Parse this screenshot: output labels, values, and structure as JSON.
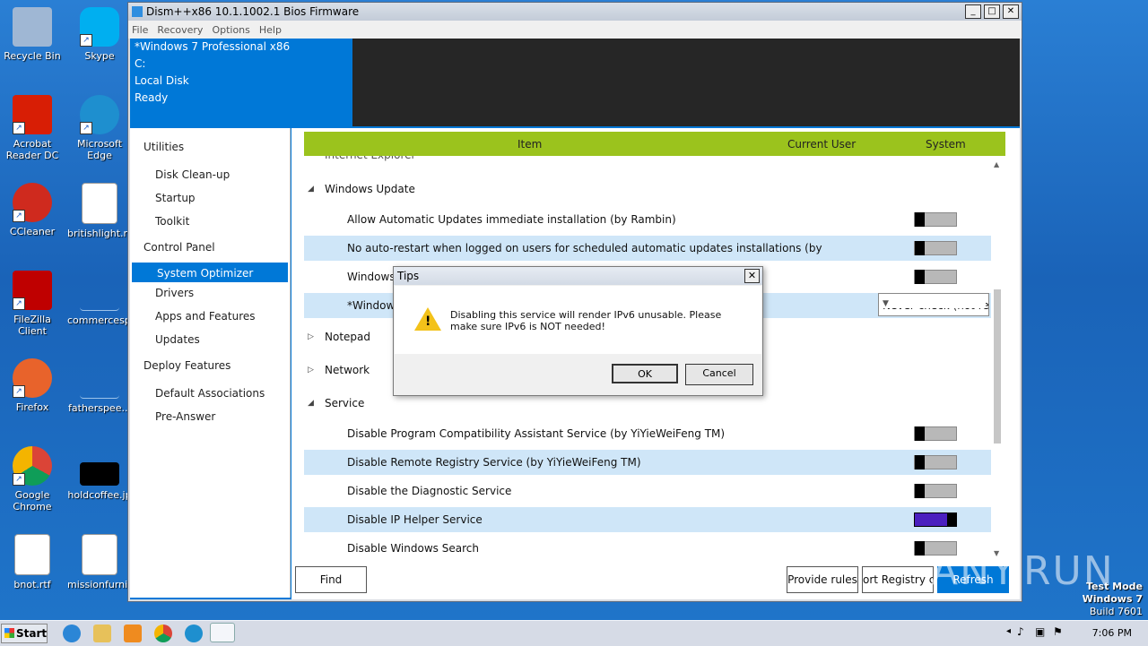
{
  "desktop": {
    "icons": [
      {
        "label": "Recycle Bin",
        "color": "#9fb7d4"
      },
      {
        "label": "Skype",
        "color": "#00aff0"
      },
      {
        "label": "Acrobat Reader DC",
        "color": "#d81e05"
      },
      {
        "label": "Microsoft Edge",
        "color": "#1e8fcf"
      },
      {
        "label": "CCleaner",
        "color": "#cf2a1e"
      },
      {
        "label": "britishlight.rtf",
        "color": "#ffffff"
      },
      {
        "label": "FileZilla Client",
        "color": "#bf0000"
      },
      {
        "label": "commercesp...",
        "color": "#2a7fd4"
      },
      {
        "label": "Firefox",
        "color": "#e8632b"
      },
      {
        "label": "fatherspee...",
        "color": "#2a7fd4"
      },
      {
        "label": "Google Chrome",
        "color": "#4285f4"
      },
      {
        "label": "holdcoffee.jp",
        "color": "#000000"
      },
      {
        "label": "bnot.rtf",
        "color": "#ffffff"
      },
      {
        "label": "missionfurni...",
        "color": "#ffffff"
      }
    ]
  },
  "window": {
    "title": "Dism++x86 10.1.1002.1 Bios Firmware",
    "menu": [
      "File",
      "Recovery",
      "Options",
      "Help"
    ],
    "info": [
      "*Windows 7 Professional x86",
      "C:",
      "Local Disk",
      "Ready"
    ]
  },
  "sidebar": {
    "utilities": "Utilities",
    "disk_cleanup": "Disk Clean-up",
    "startup": "Startup",
    "toolkit": "Toolkit",
    "control_panel": "Control Panel",
    "system_optimizer": "System Optimizer",
    "drivers": "Drivers",
    "apps_features": "Apps and Features",
    "updates": "Updates",
    "deploy_features": "Deploy Features",
    "default_assoc": "Default Associations",
    "pre_answer": "Pre-Answer"
  },
  "table": {
    "col_item": "Item",
    "col_current_user": "Current User",
    "col_system": "System",
    "partial_group": "Internet Explorer",
    "groups": {
      "windows_update": "Windows Update",
      "notepad": "Notepad",
      "network": "Network",
      "service": "Service"
    },
    "rows": {
      "wu1": "Allow Automatic Updates immediate installation (by Rambin)",
      "wu2": "No auto-restart when logged on users for scheduled automatic updates installations (by",
      "wu3": "Windows",
      "wu4": "*Window",
      "svc1": "Disable Program Compatibility Assistant Service (by YiYieWeiFeng TM)",
      "svc2": "Disable Remote Registry Service (by YiYieWeiFeng TM)",
      "svc3": "Disable the Diagnostic Service",
      "svc4": "Disable IP Helper Service",
      "svc5": "Disable Windows Search"
    },
    "dropdown_value": "Never check (not re",
    "ip_helper_on": true
  },
  "buttons": {
    "find": "Find",
    "provide_rules": "Provide rules",
    "export_registry": "ort Registry co",
    "refresh": "Refresh"
  },
  "dialog": {
    "title": "Tips",
    "message": "Disabling this service will render IPv6 unusable. Please make sure IPv6 is NOT needed!",
    "ok": "OK",
    "cancel": "Cancel"
  },
  "watermark": "ANY.RUN",
  "test_mode": {
    "line1": "Test Mode",
    "line2": "Windows 7",
    "line3": "Build 7601"
  },
  "taskbar": {
    "start": "Start",
    "clock": "7:06 PM"
  }
}
